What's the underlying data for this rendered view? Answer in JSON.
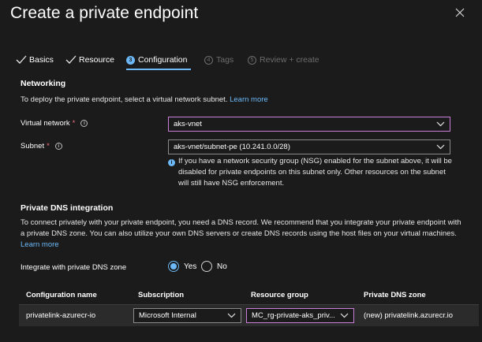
{
  "header": {
    "title": "Create a private endpoint",
    "more_label": "···"
  },
  "tabs": [
    {
      "label": "Basics",
      "state": "done"
    },
    {
      "label": "Resource",
      "state": "done"
    },
    {
      "label": "Configuration",
      "number": "3",
      "state": "active"
    },
    {
      "label": "Tags",
      "number": "4",
      "state": "disabled"
    },
    {
      "label": "Review + create",
      "number": "5",
      "state": "disabled"
    }
  ],
  "networking": {
    "heading": "Networking",
    "description": "To deploy the private endpoint, select a virtual network subnet.",
    "learn_more": "Learn more",
    "virtual_network": {
      "label": "Virtual network",
      "required": "*",
      "value": "aks-vnet"
    },
    "subnet": {
      "label": "Subnet",
      "required": "*",
      "value": "aks-vnet/subnet-pe (10.241.0.0/28)"
    },
    "nsg_notice": "If you have a network security group (NSG) enabled for the subnet above, it will be disabled for private endpoints on this subnet only. Other resources on the subnet will still have NSG enforcement."
  },
  "dns": {
    "heading": "Private DNS integration",
    "description": "To connect privately with your private endpoint, you need a DNS record. We recommend that you integrate your private endpoint with a private DNS zone. You can also utilize your own DNS servers or create DNS records using the host files on your virtual machines.",
    "learn_more": "Learn more",
    "integrate_label": "Integrate with private DNS zone",
    "options": {
      "yes": "Yes",
      "no": "No"
    },
    "selected": "yes",
    "table": {
      "columns": [
        "Configuration name",
        "Subscription",
        "Resource group",
        "Private DNS zone"
      ],
      "rows": [
        {
          "configuration_name": "privatelink-azurecr-io",
          "subscription": "Microsoft Internal",
          "resource_group": "MC_rg-private-aks_priv...",
          "private_dns_zone": "(new) privatelink.azurecr.io"
        }
      ]
    }
  },
  "colors": {
    "background": "#1b1b1b",
    "accent": "#6cb8f6",
    "required": "#f1707b",
    "focus_border": "#c97fd9"
  }
}
